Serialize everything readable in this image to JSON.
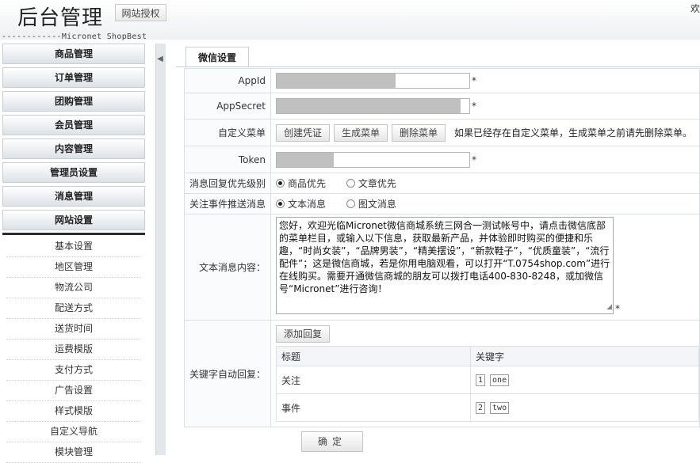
{
  "header": {
    "title": "后台管理",
    "license_button": "网站授权",
    "corner_text": "欢",
    "subtitle": "------------Micronet ShopBest"
  },
  "sidebar": {
    "groups": [
      {
        "label": "商品管理"
      },
      {
        "label": "订单管理"
      },
      {
        "label": "团购管理"
      },
      {
        "label": "会员管理"
      },
      {
        "label": "内容管理"
      },
      {
        "label": "管理员设置"
      },
      {
        "label": "消息管理"
      },
      {
        "label": "网站设置"
      }
    ],
    "sub_items": [
      {
        "label": "基本设置"
      },
      {
        "label": "地区管理"
      },
      {
        "label": "物流公司"
      },
      {
        "label": "配送方式"
      },
      {
        "label": "送货时间"
      },
      {
        "label": "运费模版"
      },
      {
        "label": "支付方式"
      },
      {
        "label": "广告设置"
      },
      {
        "label": "样式模版"
      },
      {
        "label": "自定义导航"
      },
      {
        "label": "模块管理"
      }
    ]
  },
  "main": {
    "tab_label": "微信设置",
    "appid": {
      "label": "AppId",
      "required": "*"
    },
    "appsecret": {
      "label": "AppSecret",
      "required": "*"
    },
    "custom_menu": {
      "label": "自定义菜单",
      "create_btn": "创建凭证",
      "generate_btn": "生成菜单",
      "delete_btn": "删除菜单",
      "hint": "如果已经存在自定义菜单，生成菜单之前请先删除菜单。"
    },
    "token": {
      "label": "Token",
      "required": "*"
    },
    "reply_priority": {
      "label": "消息回复优先级别",
      "option1": "商品优先",
      "option2": "文章优先",
      "selected": "商品优先"
    },
    "event_push": {
      "label": "关注事件推送消息",
      "option1": "文本消息",
      "option2": "图文消息",
      "selected": "文本消息"
    },
    "text_message": {
      "label": "文本消息内容：",
      "content": "您好，欢迎光临Micronet微信商城系统三网合一测试帐号中，请点击微信底部的菜单栏目，或输入以下信息，获取最新产品，并体验即时购买的便捷和乐趣，“时尚女装”，“品牌男装”，“精美摆设”，“新款鞋子”，“优质童装”，“流行配件”；这是微信商城，若是你用电脑观看，可以打开“T.0754shop.com”进行在线购买。需要开通微信商城的朋友可以拨打电话400-830-8248，或加微信号“Micronet”进行咨询！",
      "required": "*"
    },
    "keyword_reply": {
      "label": "关键字自动回复：",
      "add_btn": "添加回复",
      "col_title": "标题",
      "col_keyword": "关键字",
      "rows": [
        {
          "title": "关注",
          "num": "1",
          "keyword": "one"
        },
        {
          "title": "事件",
          "num": "2",
          "keyword": "two"
        }
      ]
    },
    "confirm_btn": "确定"
  }
}
